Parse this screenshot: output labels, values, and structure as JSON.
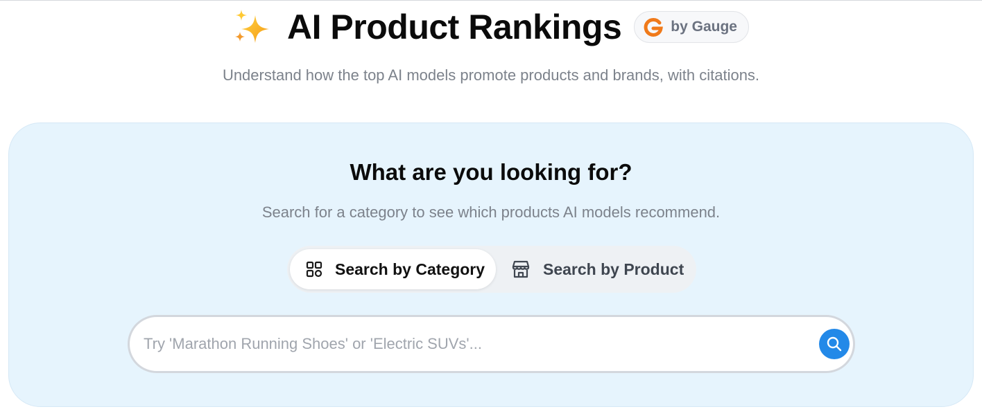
{
  "header": {
    "title": "AI Product Rankings",
    "badge_label": "by Gauge",
    "subtitle": "Understand how the top AI models promote products and brands, with citations.",
    "title_icon": "sparkles-icon",
    "badge_icon": "gauge-logo-icon"
  },
  "search_card": {
    "title": "What are you looking for?",
    "subtitle": "Search for a category to see which products AI models recommend.",
    "tabs": [
      {
        "label": "Search by Category",
        "icon": "grid-icon",
        "active": true
      },
      {
        "label": "Search by Product",
        "icon": "storefront-icon",
        "active": false
      }
    ],
    "input": {
      "placeholder": "Try 'Marathon Running Shoes' or 'Electric SUVs'...",
      "value": ""
    },
    "search_button_icon": "search-icon"
  },
  "colors": {
    "card_background": "#e6f4fd",
    "accent_blue": "#2389e8",
    "gauge_orange": "#f07a1a"
  }
}
